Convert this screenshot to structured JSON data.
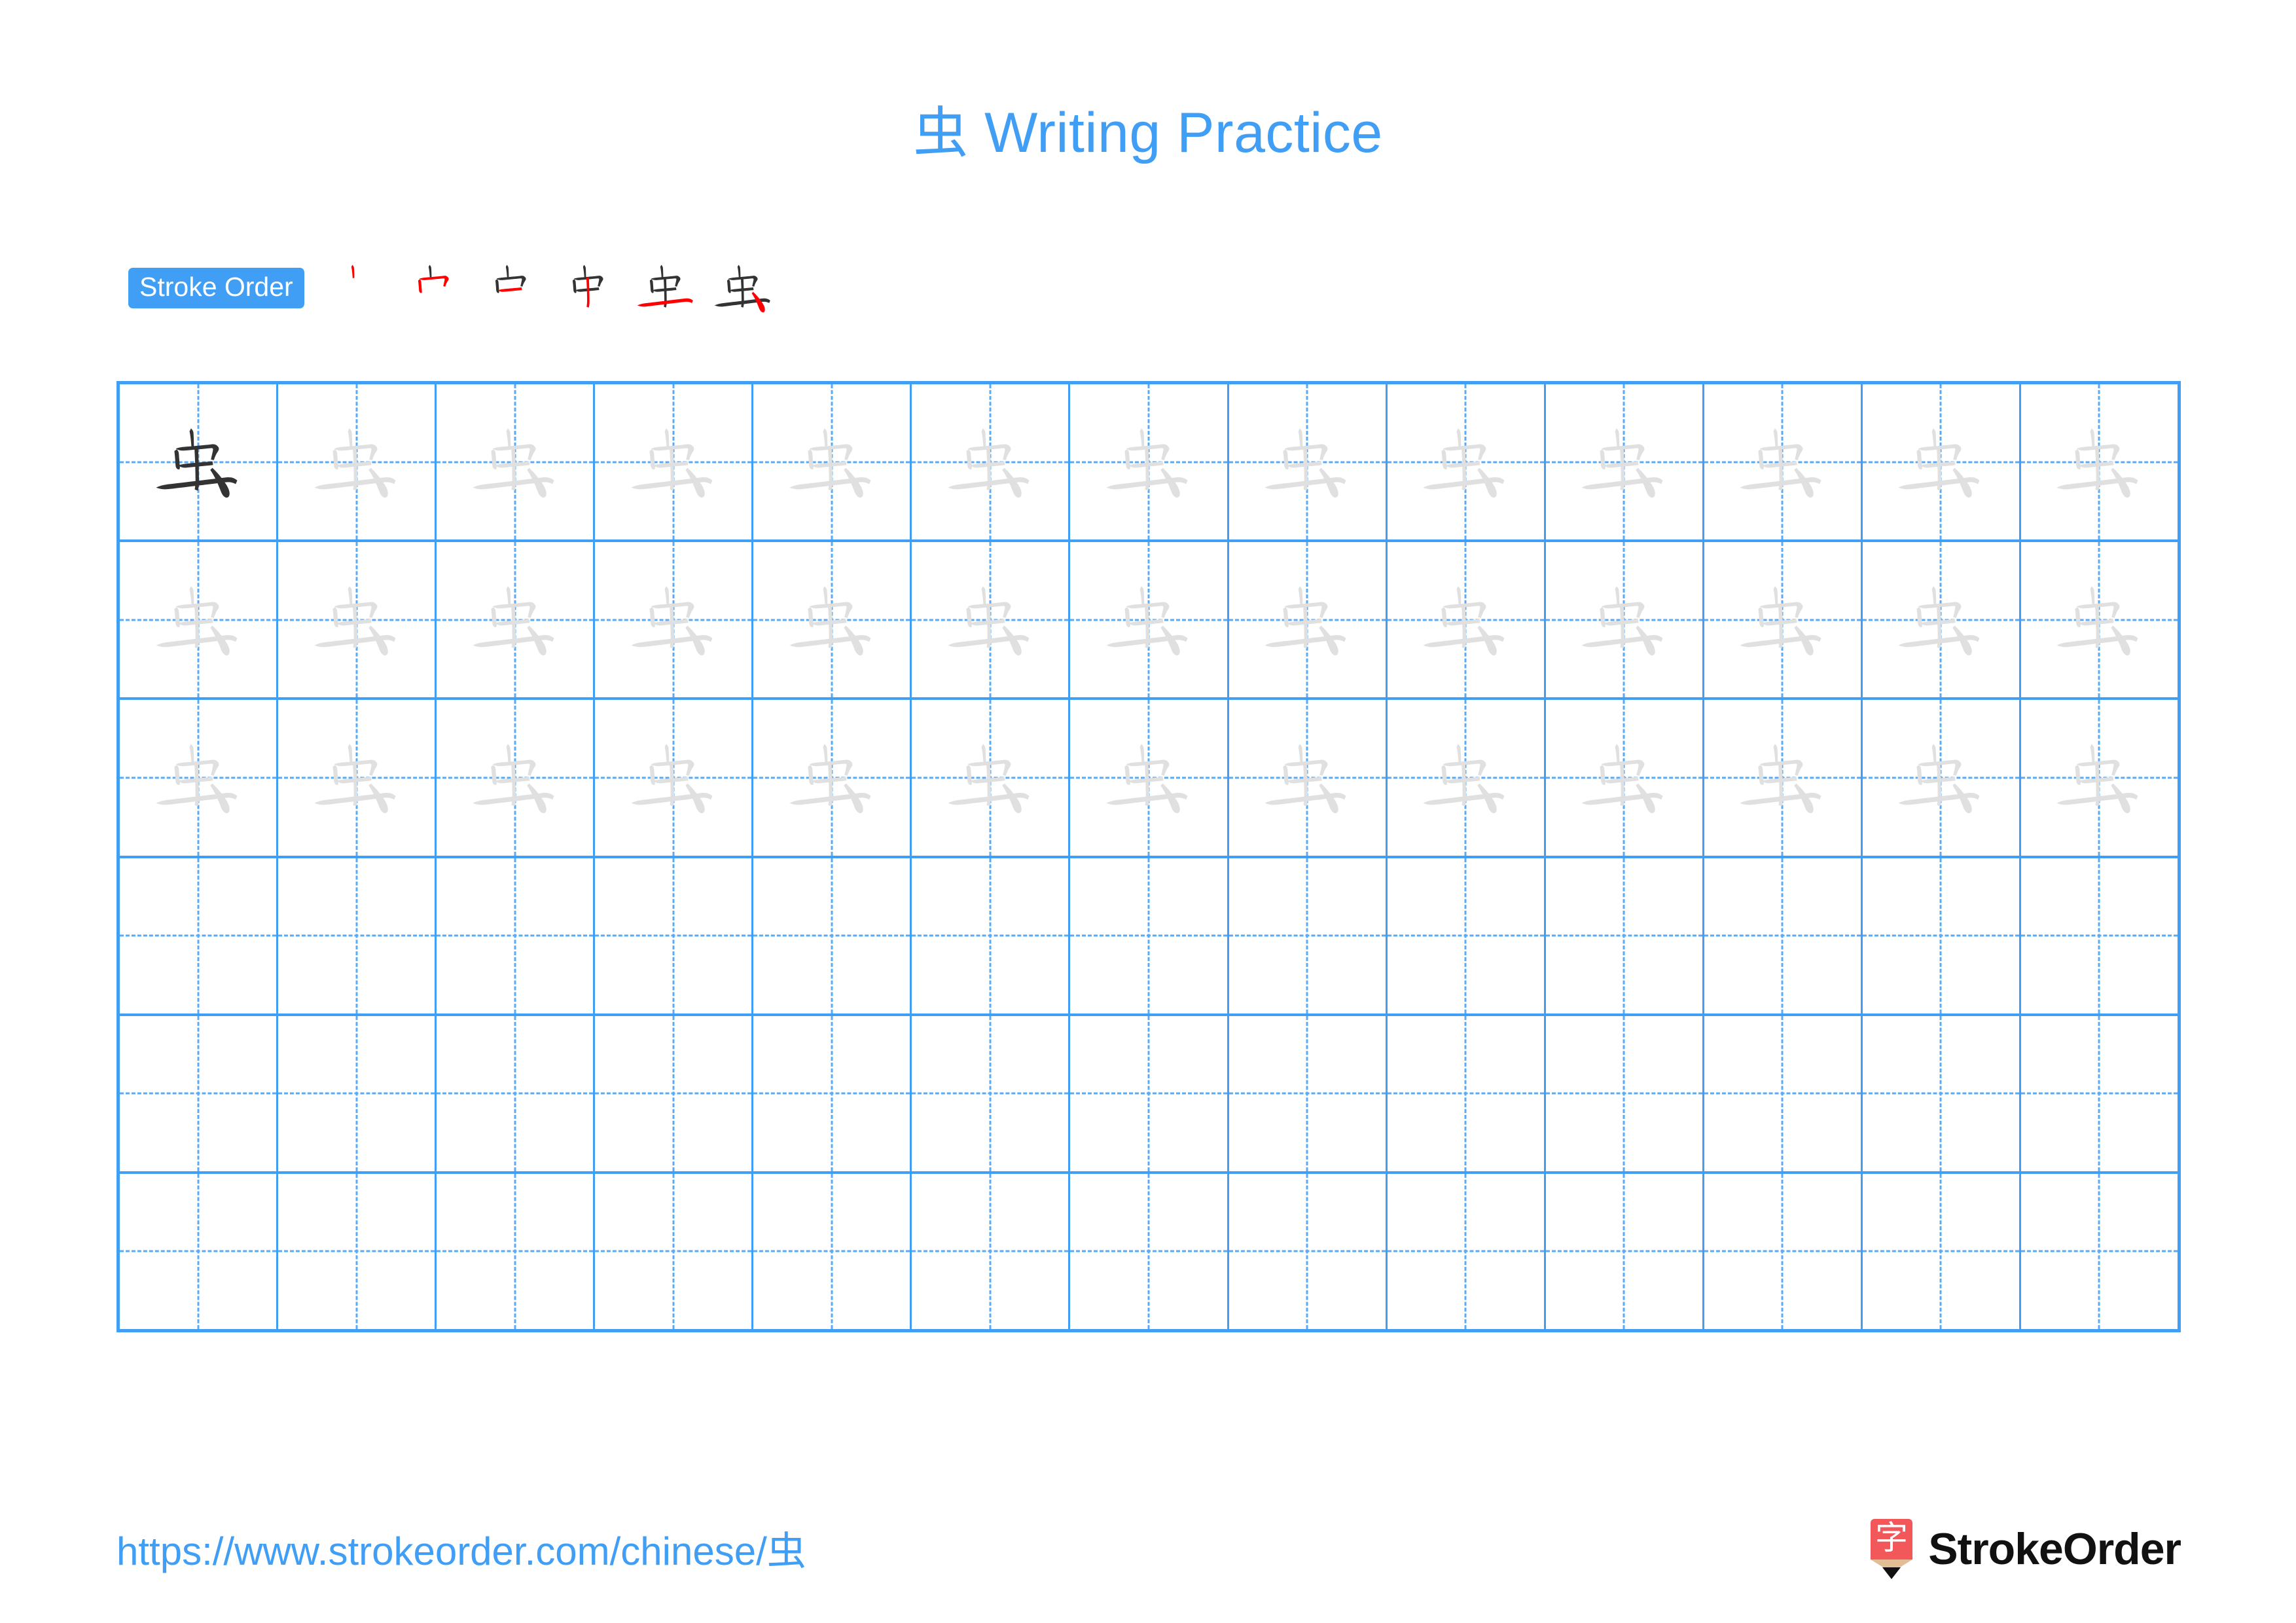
{
  "page": {
    "title_character": "虫",
    "title_suffix": " Writing Practice",
    "title_full": "虫 Writing Practice",
    "accent_color": "#419ef5",
    "stroke_new_color": "#ff0000",
    "stroke_done_color": "#333333",
    "trace_color": "#e0e0e0",
    "model_color": "#333333"
  },
  "stroke_order": {
    "badge_label": "Stroke Order",
    "character": "虫",
    "total_strokes": 6,
    "steps": [
      {
        "index": 1,
        "strokes_shown": 1,
        "new_stroke_name": "shu"
      },
      {
        "index": 2,
        "strokes_shown": 2,
        "new_stroke_name": "hengzhe"
      },
      {
        "index": 3,
        "strokes_shown": 3,
        "new_stroke_name": "heng"
      },
      {
        "index": 4,
        "strokes_shown": 4,
        "new_stroke_name": "shu-long"
      },
      {
        "index": 5,
        "strokes_shown": 5,
        "new_stroke_name": "heng-bottom"
      },
      {
        "index": 6,
        "strokes_shown": 6,
        "new_stroke_name": "dian"
      }
    ]
  },
  "practice_grid": {
    "columns": 13,
    "rows": 6,
    "cells": [
      [
        "model",
        "trace",
        "trace",
        "trace",
        "trace",
        "trace",
        "trace",
        "trace",
        "trace",
        "trace",
        "trace",
        "trace",
        "trace"
      ],
      [
        "trace",
        "trace",
        "trace",
        "trace",
        "trace",
        "trace",
        "trace",
        "trace",
        "trace",
        "trace",
        "trace",
        "trace",
        "trace"
      ],
      [
        "trace",
        "trace",
        "trace",
        "trace",
        "trace",
        "trace",
        "trace",
        "trace",
        "trace",
        "trace",
        "trace",
        "trace",
        "trace"
      ],
      [
        "empty",
        "empty",
        "empty",
        "empty",
        "empty",
        "empty",
        "empty",
        "empty",
        "empty",
        "empty",
        "empty",
        "empty",
        "empty"
      ],
      [
        "empty",
        "empty",
        "empty",
        "empty",
        "empty",
        "empty",
        "empty",
        "empty",
        "empty",
        "empty",
        "empty",
        "empty",
        "empty"
      ],
      [
        "empty",
        "empty",
        "empty",
        "empty",
        "empty",
        "empty",
        "empty",
        "empty",
        "empty",
        "empty",
        "empty",
        "empty",
        "empty"
      ]
    ]
  },
  "footer": {
    "url_text": "https://www.strokeorder.com/chinese/",
    "url_character": "虫",
    "brand_name": "StrokeOrder",
    "brand_mark_character": "字",
    "brand_mark_color": "#f2575a",
    "brand_mark_tip_color": "#e3bd95"
  }
}
